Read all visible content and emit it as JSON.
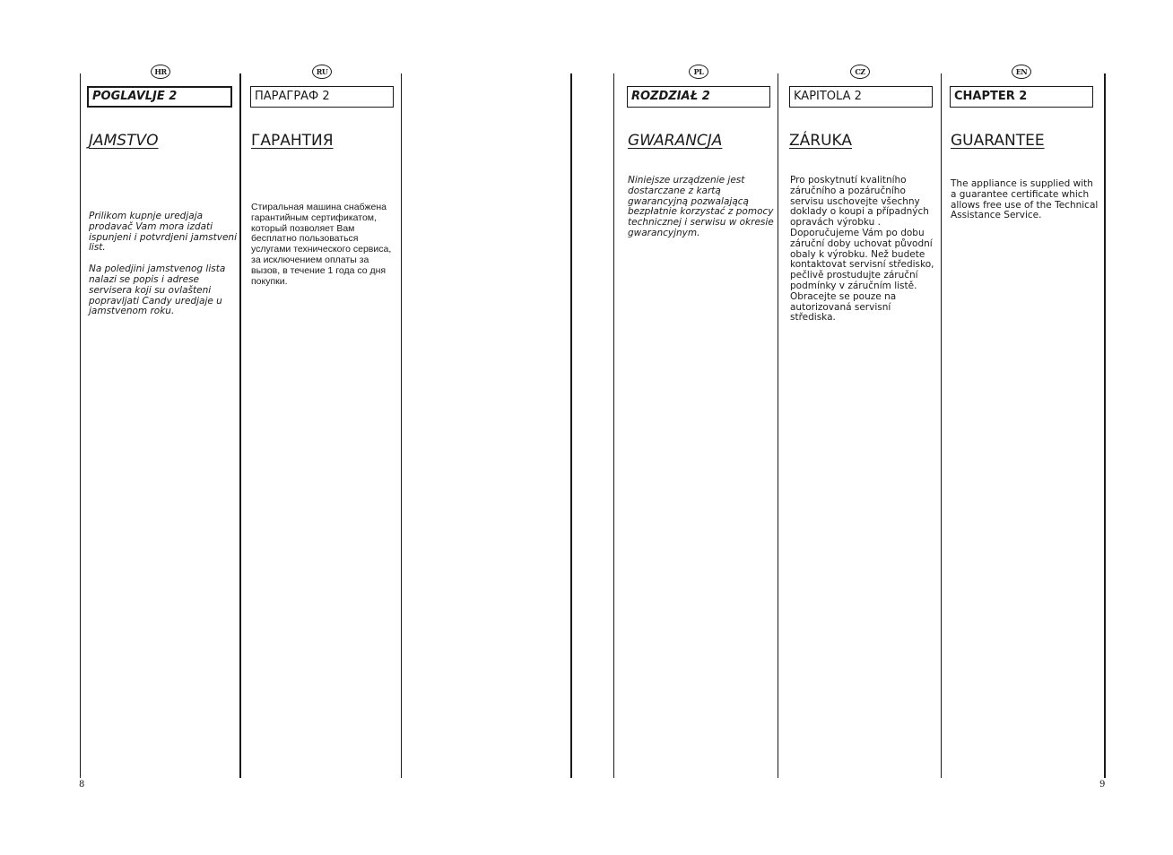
{
  "pages": {
    "left": {
      "page_number": "8",
      "columns": [
        {
          "lang_code": "HR",
          "chapter": "POGLAVLJE 2",
          "title": "JAMSTVO",
          "paragraphs": [
            "Prilikom kupnje uredjaja prodavač Vam mora izdati ispunjeni i potvrdjeni jamstveni list.",
            "Na poledjini jamstvenog lista nalazi se popis i adrese servisera koji su ovlašteni popravljati Candy uredjaje u jamstvenom roku."
          ]
        },
        {
          "lang_code": "RU",
          "chapter": "ПАРАГРАФ 2",
          "title": "ГАРАНТИЯ",
          "paragraphs": [
            "Стиральная машина снабжена гарантийным сертификатом, который позволяет Вам бесплатно пользоваться услугами технического сервиса, за исключением оплаты за вызов, в течение 1 года со дня покупки."
          ]
        }
      ]
    },
    "right": {
      "page_number": "9",
      "columns": [
        {
          "lang_code": "PL",
          "chapter": "ROZDZIAŁ 2",
          "title": "GWARANCJA",
          "paragraphs": [
            "Niniejsze urządzenie jest dostarczane z kartą gwarancyjną pozwalającą bezpłatnie korzystać z pomocy technicznej i serwisu w okresie gwarancyjnym."
          ]
        },
        {
          "lang_code": "CZ",
          "chapter": "KAPITOLA 2",
          "title": "ZÁRUKA",
          "paragraphs": [
            "Pro poskytnutí kvalitního záručního a pozáručního servisu uschovejte všechny doklady o koupi a případných opravách výrobku . Doporučujeme Vám po dobu záruční doby uchovat původní obaly k výrobku. Než budete kontaktovat servisní středisko, pečlivě prostudujte záruční podmínky v záručním listě. Obracejte se pouze na autorizovaná servisní střediska."
          ]
        },
        {
          "lang_code": "EN",
          "chapter": "CHAPTER 2",
          "title": "GUARANTEE",
          "paragraphs": [
            "The appliance is supplied with a guarantee certificate which allows free use of the Technical Assistance Service."
          ]
        }
      ]
    }
  }
}
